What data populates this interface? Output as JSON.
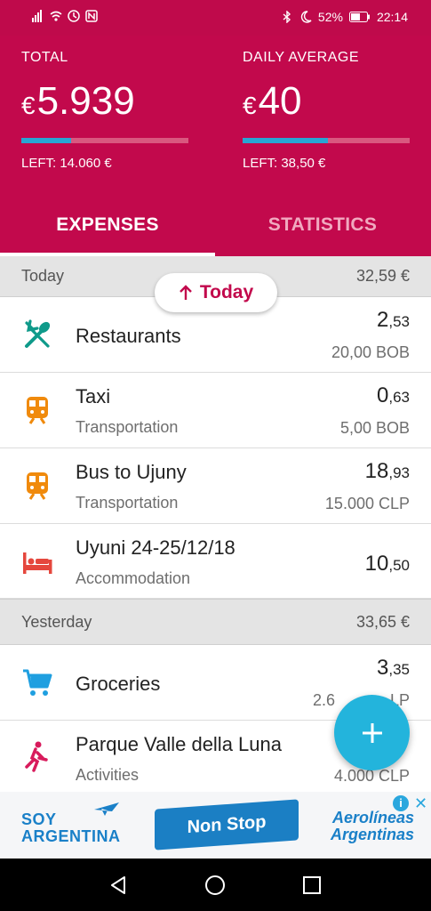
{
  "status_bar": {
    "battery": "52%",
    "time": "22:14"
  },
  "header": {
    "total": {
      "label": "TOTAL",
      "currency": "€",
      "value": "5.939",
      "left": "LEFT: 14.060 €",
      "progress": 0.3
    },
    "daily": {
      "label": "DAILY AVERAGE",
      "currency": "€",
      "value": "40",
      "left": "LEFT: 38,50 €",
      "progress": 0.51
    }
  },
  "tabs": [
    {
      "label": "EXPENSES",
      "active": true
    },
    {
      "label": "STATISTICS",
      "active": false
    }
  ],
  "scroll_pill": {
    "label": "Today"
  },
  "sections": [
    {
      "label": "Today",
      "total": "32,59 €",
      "items": [
        {
          "icon": "fork-knife-icon",
          "title": "Restaurants",
          "category": "",
          "amount_int": "2",
          "amount_dec": ",53",
          "original": "20,00 BOB",
          "color": "#0f9a8a"
        },
        {
          "icon": "train-icon",
          "title": "Taxi",
          "category": "Transportation",
          "amount_int": "0",
          "amount_dec": ",63",
          "original": "5,00 BOB",
          "color": "#f08a0c"
        },
        {
          "icon": "train-icon",
          "title": "Bus to Ujuny",
          "category": "Transportation",
          "amount_int": "18",
          "amount_dec": ",93",
          "original": "15.000 CLP",
          "color": "#f08a0c"
        },
        {
          "icon": "bed-icon",
          "title": "Uyuni 24-25/12/18",
          "category": "Accommodation",
          "amount_int": "10",
          "amount_dec": ",50",
          "original": "",
          "color": "#e5473d"
        }
      ]
    },
    {
      "label": "Yesterday",
      "total": "33,65 €",
      "items": [
        {
          "icon": "cart-icon",
          "title": "Groceries",
          "category": "",
          "amount_int": "3",
          "amount_dec": ",35",
          "original": "2.6",
          "original_tail": "LP",
          "color": "#1f9fe0"
        },
        {
          "icon": "hiker-icon",
          "title": "Parque Valle della Luna",
          "category": "Activities",
          "amount_int": "",
          "amount_dec": "",
          "original": "4.000 CLP",
          "color": "#d81b5c"
        }
      ]
    }
  ],
  "ad": {
    "left_text_1": "SOY",
    "left_text_2": "ARGENTINA",
    "center_text": "Non Stop",
    "right_text_1": "Aerolíneas",
    "right_text_2": "Argentinas"
  },
  "colors": {
    "primary": "#c2094c",
    "accent": "#28a6d3",
    "fab": "#23b4dc"
  }
}
